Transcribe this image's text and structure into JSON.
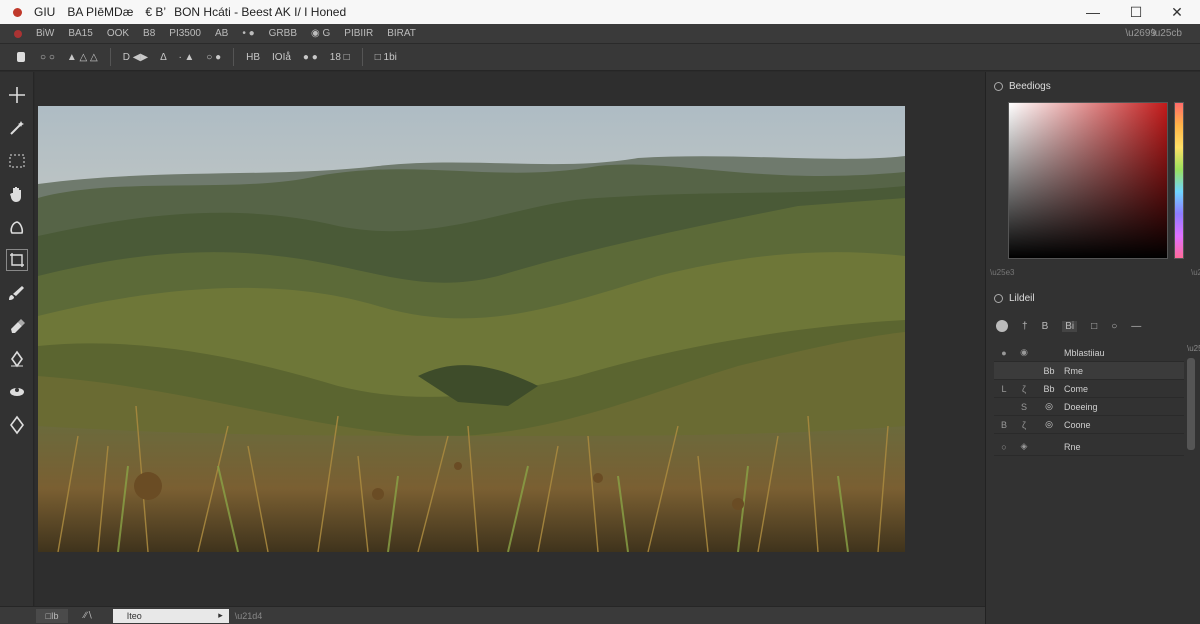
{
  "titlebar": {
    "menu": [
      "GIU",
      "BA PIēMDæ",
      "€ B’"
    ],
    "title": "BON Hcáti - Beest AK I/ I Honed",
    "minimize": "—",
    "maximize": "☐",
    "close": "✕"
  },
  "menubar": {
    "items": [
      "BiW",
      "BA15",
      "OOK",
      "B8",
      "PI3500",
      "AB",
      "• ●",
      "GRBB",
      "◉ G",
      "PIBIIR",
      "BIRAT"
    ]
  },
  "tooloptions": {
    "items": [
      "○ ○",
      "▲ △ △",
      "D ◀▶",
      "Δ",
      "∙ ▲",
      "○ ●",
      "HB",
      "IOIå",
      "● ●",
      "18 □",
      "□ 1bi"
    ]
  },
  "tools": [
    {
      "name": "move-tool",
      "label": "┼"
    },
    {
      "name": "magic-wand-tool",
      "label": "✦"
    },
    {
      "name": "marquee-tool",
      "label": "⬚"
    },
    {
      "name": "hand-tool",
      "label": "✋"
    },
    {
      "name": "lasso-tool",
      "label": "⬠"
    },
    {
      "name": "crop-tool",
      "label": "⛶"
    },
    {
      "name": "brush-tool",
      "label": "✎"
    },
    {
      "name": "eraser-tool",
      "label": "✲"
    },
    {
      "name": "pen-tool",
      "label": "✒"
    },
    {
      "name": "clone-tool",
      "label": "❀"
    },
    {
      "name": "shape-tool",
      "label": "♦"
    }
  ],
  "panels": {
    "color_title": "Beediogs",
    "layers_title": "Lildeil",
    "layer_tools": [
      "●",
      "†",
      "B",
      "Bi",
      "□",
      "○",
      "—"
    ],
    "layers": [
      {
        "c1": "●",
        "c2": "◉",
        "c3": "",
        "name": "Mblastiiau",
        "sel": false
      },
      {
        "c1": "",
        "c2": "",
        "c3": "Bb",
        "name": "Rme",
        "sel": true
      },
      {
        "c1": "L",
        "c2": "ζ",
        "c3": "Bb",
        "name": "Come",
        "sel": false
      },
      {
        "c1": "",
        "c2": "S",
        "c3": "◎",
        "name": "Doeeing",
        "sel": false
      },
      {
        "c1": "B",
        "c2": "ζ",
        "c3": "◎",
        "name": "Coone",
        "sel": false
      },
      {
        "c1": "○",
        "c2": "◈",
        "c3": "",
        "name": "Rne",
        "sel": false
      }
    ]
  },
  "status": {
    "zoom": "□Ib",
    "tool": "∕∕∖",
    "dropdown": "Iteo",
    "dropdown_arrow": "▸"
  },
  "colors": {
    "accent": "#c21a1a",
    "panel_bg": "#323232",
    "canvas_bg": "#2e2e2e"
  }
}
